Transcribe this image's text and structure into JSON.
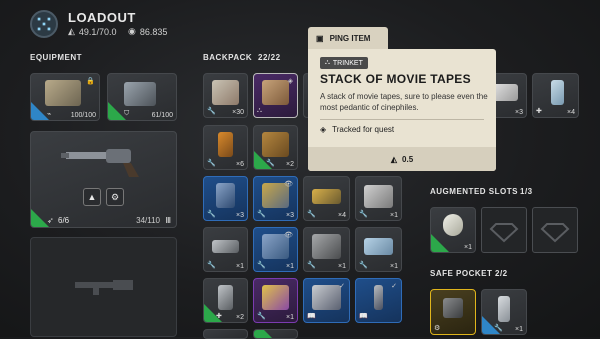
{
  "header": {
    "title": "LOADOUT",
    "weight": "49.1/70.0",
    "currency": "86.835"
  },
  "sections": {
    "equipment": "EQUIPMENT",
    "backpack": "BACKPACK",
    "backpack_count": "22/22",
    "augmented": "AUGMENTED SLOTS",
    "augmented_count": "1/3",
    "safe_pocket": "SAFE POCKET",
    "safe_pocket_count": "2/2"
  },
  "equipment": {
    "augment_durability": "100/100",
    "shield_durability": "61/100",
    "weapon_ammo": "6/6",
    "weapon_durability": "34/110"
  },
  "tooltip": {
    "ping": "PING ITEM",
    "category": "TRINKET",
    "name": "STACK OF MOVIE TAPES",
    "description": "A stack of movie tapes, sure to please even the most pedantic of cinephiles.",
    "quest": "Tracked for quest",
    "weight": "0.5"
  },
  "backpack": {
    "r1": [
      "×30",
      "",
      "",
      "",
      ""
    ],
    "r2": [
      "×6",
      "×2"
    ],
    "r3": [
      "×3",
      "×3",
      "×4",
      "×1"
    ],
    "r4": [
      "×1",
      "×1",
      "×1",
      "×1"
    ],
    "r5": [
      "×2",
      "×1",
      "",
      ""
    ]
  },
  "right_items": [
    "×3",
    "×4"
  ],
  "augmented_qty": "×1",
  "safe_pocket_qty": [
    "",
    "×1"
  ],
  "colors": {
    "green": "#2ca84a",
    "blue": "#2f86c7",
    "purple": "#9a3fd0",
    "yellow": "#e0b51c",
    "tooltip_bg": "#e9e3d2"
  }
}
